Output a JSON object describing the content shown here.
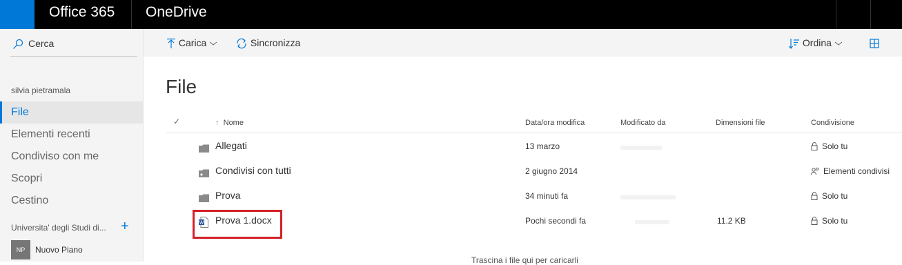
{
  "suitebar": {
    "brand": "Office 365",
    "app_name": "OneDrive"
  },
  "leftnav": {
    "search_label": "Cerca",
    "user_name": "silvia pietramala",
    "items": [
      {
        "label": "File",
        "selected": true
      },
      {
        "label": "Elementi recenti"
      },
      {
        "label": "Condiviso con me"
      },
      {
        "label": "Scopri"
      },
      {
        "label": "Cestino"
      }
    ],
    "group_label": "Universita' degli Studi di...",
    "site": {
      "badge": "NP",
      "name": "Nuovo Piano"
    }
  },
  "commandbar": {
    "upload": "Carica",
    "sync": "Sincronizza",
    "sort": "Ordina"
  },
  "main": {
    "title": "File",
    "columns": {
      "name": "Nome",
      "modified": "Data/ora modifica",
      "modified_by": "Modificato da",
      "size": "Dimensioni file",
      "sharing": "Condivisione"
    },
    "rows": [
      {
        "name": "Allegati",
        "type": "folder",
        "modified": "13 marzo",
        "size": "",
        "sharing": "Solo tu",
        "sharing_icon": "lock-icon"
      },
      {
        "name": "Condivisi con tutti",
        "type": "shared-folder",
        "modified": "2 giugno 2014",
        "size": "",
        "sharing": "Elementi condivisi",
        "sharing_icon": "people-icon"
      },
      {
        "name": "Prova",
        "type": "folder",
        "modified": "34 minuti fa",
        "size": "",
        "sharing": "Solo tu",
        "sharing_icon": "lock-icon"
      },
      {
        "name": "Prova 1.docx",
        "type": "word-document",
        "modified": "Pochi secondi fa",
        "size": "11.2 KB",
        "sharing": "Solo tu",
        "sharing_icon": "lock-icon"
      }
    ],
    "footer_text": "Trascina i file qui per caricarli"
  },
  "colors": {
    "suitebar": "#000000",
    "accent": "#0078d7",
    "highlight": "#d32027"
  }
}
